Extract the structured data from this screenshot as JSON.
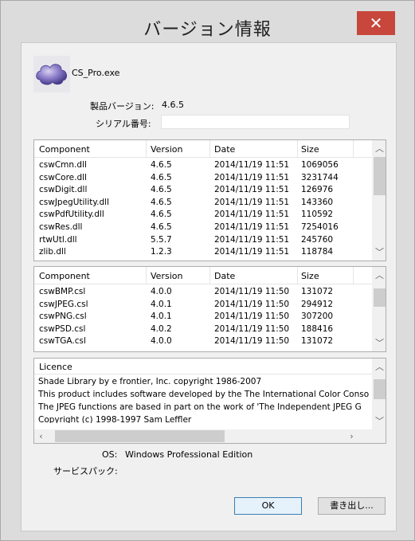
{
  "window": {
    "title": "バージョン情報",
    "close_glyph": "✕"
  },
  "app": {
    "exe_name": "CS_Pro.exe",
    "version_label": "製品バージョン:",
    "version_value": "4.6.5",
    "serial_label": "シリアル番号:",
    "serial_value": ""
  },
  "modules": {
    "headers": [
      "Component",
      "Version",
      "Date",
      "Size"
    ],
    "rows": [
      [
        "cswCmn.dll",
        "4.6.5",
        "2014/11/19 11:51",
        "1069056"
      ],
      [
        "cswCore.dll",
        "4.6.5",
        "2014/11/19 11:51",
        "3231744"
      ],
      [
        "cswDigit.dll",
        "4.6.5",
        "2014/11/19 11:51",
        "126976"
      ],
      [
        "cswJpegUtility.dll",
        "4.6.5",
        "2014/11/19 11:51",
        "143360"
      ],
      [
        "cswPdfUtility.dll",
        "4.6.5",
        "2014/11/19 11:51",
        "110592"
      ],
      [
        "cswRes.dll",
        "4.6.5",
        "2014/11/19 11:51",
        "7254016"
      ],
      [
        "rtwUtl.dll",
        "5.5.7",
        "2014/11/19 11:51",
        "245760"
      ],
      [
        "zlib.dll",
        "1.2.3",
        "2014/11/19 11:51",
        "118784"
      ]
    ]
  },
  "plugins": {
    "headers": [
      "Component",
      "Version",
      "Date",
      "Size"
    ],
    "rows": [
      [
        "cswBMP.csl",
        "4.0.0",
        "2014/11/19 11:50",
        "131072"
      ],
      [
        "cswJPEG.csl",
        "4.0.1",
        "2014/11/19 11:50",
        "294912"
      ],
      [
        "cswPNG.csl",
        "4.0.1",
        "2014/11/19 11:50",
        "307200"
      ],
      [
        "cswPSD.csl",
        "4.0.2",
        "2014/11/19 11:50",
        "188416"
      ],
      [
        "cswTGA.csl",
        "4.0.0",
        "2014/11/19 11:50",
        "131072"
      ]
    ]
  },
  "licence": {
    "header": "Licence",
    "lines": [
      "Shade Library by e frontier, Inc. copyright 1986-2007",
      "This product includes software developed by the The International Color Conso",
      "The JPEG functions are based in part on the work of 'The Independent JPEG G",
      "Copyright (c) 1998-1997 Sam Leffler"
    ]
  },
  "system": {
    "os_label": "OS:",
    "os_value": "Windows Professional Edition",
    "sp_label": "サービスパック:",
    "sp_value": ""
  },
  "buttons": {
    "ok": "OK",
    "export": "書き出し..."
  },
  "colors": {
    "close_button": "#c7473c",
    "selection_border": "#3c7fb1"
  },
  "icons": {
    "app": "cloud-icon",
    "scroll_up": "chevron-up-icon",
    "scroll_down": "chevron-down-icon",
    "scroll_left": "chevron-left-icon",
    "scroll_right": "chevron-right-icon"
  }
}
